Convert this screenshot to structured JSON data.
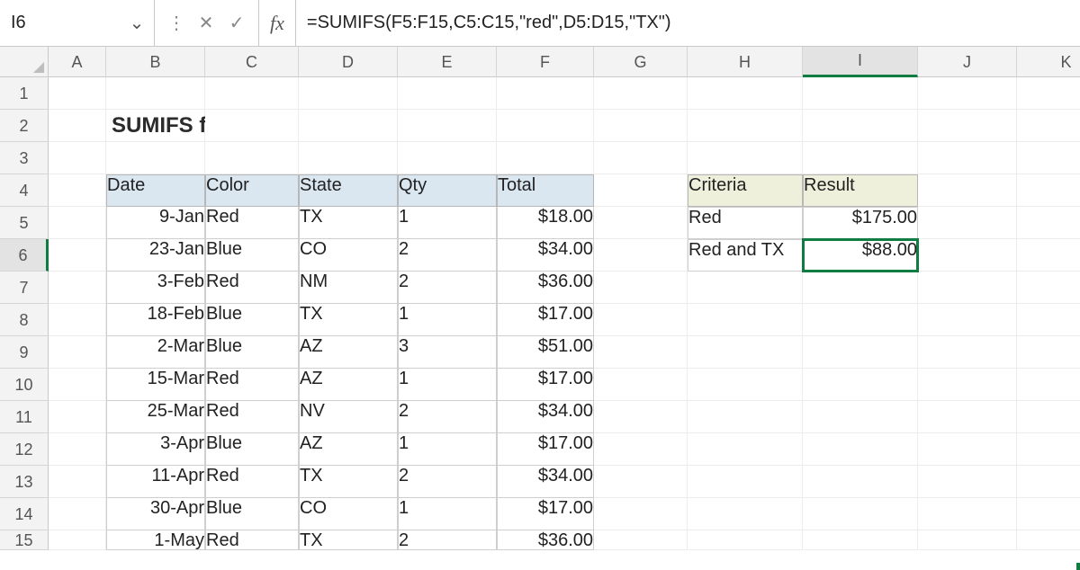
{
  "formula_bar": {
    "cell_ref": "I6",
    "formula": "=SUMIFS(F5:F15,C5:C15,\"red\",D5:D15,\"TX\")"
  },
  "columns": [
    "A",
    "B",
    "C",
    "D",
    "E",
    "F",
    "G",
    "H",
    "I",
    "J",
    "K"
  ],
  "active_col": "I",
  "rows": [
    "1",
    "2",
    "3",
    "4",
    "5",
    "6",
    "7",
    "8",
    "9",
    "10",
    "11",
    "12",
    "13",
    "14",
    "15"
  ],
  "active_row": "6",
  "title_cell": {
    "text": "SUMIFS function"
  },
  "table": {
    "headers": [
      "Date",
      "Color",
      "State",
      "Qty",
      "Total"
    ],
    "rows": [
      {
        "date": "9-Jan",
        "color": "Red",
        "state": "TX",
        "qty": "1",
        "total": "$18.00"
      },
      {
        "date": "23-Jan",
        "color": "Blue",
        "state": "CO",
        "qty": "2",
        "total": "$34.00"
      },
      {
        "date": "3-Feb",
        "color": "Red",
        "state": "NM",
        "qty": "2",
        "total": "$36.00"
      },
      {
        "date": "18-Feb",
        "color": "Blue",
        "state": "TX",
        "qty": "1",
        "total": "$17.00"
      },
      {
        "date": "2-Mar",
        "color": "Blue",
        "state": "AZ",
        "qty": "3",
        "total": "$51.00"
      },
      {
        "date": "15-Mar",
        "color": "Red",
        "state": "AZ",
        "qty": "1",
        "total": "$17.00"
      },
      {
        "date": "25-Mar",
        "color": "Red",
        "state": "NV",
        "qty": "2",
        "total": "$34.00"
      },
      {
        "date": "3-Apr",
        "color": "Blue",
        "state": "AZ",
        "qty": "1",
        "total": "$17.00"
      },
      {
        "date": "11-Apr",
        "color": "Red",
        "state": "TX",
        "qty": "2",
        "total": "$34.00"
      },
      {
        "date": "30-Apr",
        "color": "Blue",
        "state": "CO",
        "qty": "1",
        "total": "$17.00"
      },
      {
        "date": "1-May",
        "color": "Red",
        "state": "TX",
        "qty": "2",
        "total": "$36.00"
      }
    ]
  },
  "results": {
    "headers": [
      "Criteria",
      "Result"
    ],
    "rows": [
      {
        "criteria": "Red",
        "value": "$175.00"
      },
      {
        "criteria": "Red and TX",
        "value": "$88.00"
      }
    ]
  }
}
